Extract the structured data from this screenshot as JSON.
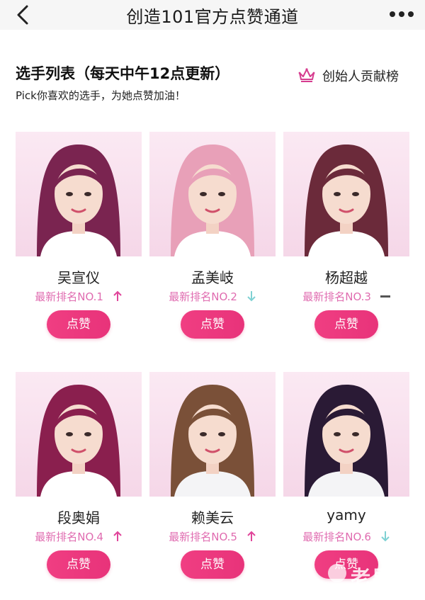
{
  "nav": {
    "title": "创造101官方点赞通道",
    "back_icon": "back-chevron-icon",
    "more_icon": "more-dots-icon"
  },
  "section": {
    "title": "选手列表（每天中午12点更新）",
    "subtitle": "Pick你喜欢的选手，为她点赞加油！",
    "rank_link": {
      "label": "创始人贡献榜",
      "icon": "crown-icon",
      "color": "#d63c8f"
    }
  },
  "colors": {
    "accent": "#ec3a7f",
    "rank_text": "#e06cb0",
    "up": "#e0459a",
    "down": "#7fd1d3",
    "same": "#555555"
  },
  "contestants": [
    {
      "name": "吴宣仪",
      "rank_text": "最新排名NO.1",
      "trend": "up",
      "button": "点赞"
    },
    {
      "name": "孟美岐",
      "rank_text": "最新排名NO.2",
      "trend": "down",
      "button": "点赞"
    },
    {
      "name": "杨超越",
      "rank_text": "最新排名NO.3",
      "trend": "same",
      "button": "点赞"
    },
    {
      "name": "段奥娟",
      "rank_text": "最新排名NO.4",
      "trend": "up",
      "button": "点赞"
    },
    {
      "name": "赖美云",
      "rank_text": "最新排名NO.5",
      "trend": "up",
      "button": "点赞"
    },
    {
      "name": "yamy",
      "rank_text": "最新排名NO.6",
      "trend": "down",
      "button": "点赞"
    }
  ],
  "watermark": {
    "text": "老男",
    "url": "laonanren.com"
  }
}
